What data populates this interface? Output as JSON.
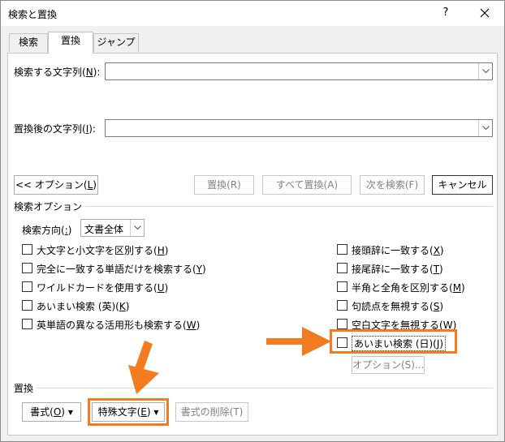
{
  "window": {
    "title": "検索と置換",
    "help_glyph": "?",
    "close_icon": "close-icon"
  },
  "tabs": [
    {
      "label": "検索",
      "active": false
    },
    {
      "label": "置換",
      "active": true
    },
    {
      "label": "ジャンプ",
      "active": false
    }
  ],
  "find": {
    "label_prefix": "検索する文字列(",
    "label_key": "N",
    "label_suffix": "):",
    "value": ""
  },
  "replace": {
    "label_prefix": "置換後の文字列(",
    "label_key": "I",
    "label_suffix": "):",
    "value": ""
  },
  "buttons": {
    "options_prefix": "<< オプション(",
    "options_key": "L",
    "options_suffix": ")",
    "replace": "置換(R)",
    "replace_all": "すべて置換(A)",
    "find_next": "次を検索(F)",
    "cancel": "キャンセル"
  },
  "search_options": {
    "title": "検索オプション",
    "direction_prefix": "検索方向(",
    "direction_key": ":",
    "direction_suffix": ")",
    "direction_value": "文書全体",
    "left": [
      {
        "prefix": "大文字と小文字を区別する(",
        "key": "H",
        "suffix": ")",
        "checked": false
      },
      {
        "prefix": "完全に一致する単語だけを検索する(",
        "key": "Y",
        "suffix": ")",
        "checked": false
      },
      {
        "prefix": "ワイルドカードを使用する(",
        "key": "U",
        "suffix": ")",
        "checked": false
      },
      {
        "prefix": "あいまい検索 (英)(",
        "key": "K",
        "suffix": ")",
        "checked": false
      },
      {
        "prefix": "英単語の異なる活用形も検索する(",
        "key": "W",
        "suffix": ")",
        "checked": false
      }
    ],
    "right": [
      {
        "prefix": "接頭辞に一致する(",
        "key": "X",
        "suffix": ")",
        "checked": false
      },
      {
        "prefix": "接尾辞に一致する(",
        "key": "T",
        "suffix": ")",
        "checked": false
      },
      {
        "prefix": "半角と全角を区別する(",
        "key": "M",
        "suffix": ")",
        "checked": false
      },
      {
        "prefix": "句読点を無視する(",
        "key": "S",
        "suffix": ")",
        "checked": false
      },
      {
        "prefix": "空白文字を無視する(",
        "key": "W",
        "suffix": ")",
        "checked": false
      },
      {
        "prefix": "あいまい検索 (日)(",
        "key": "J",
        "suffix": ")",
        "checked": false
      }
    ],
    "fuzzy_options_button": "オプション(S)..."
  },
  "replace_group": {
    "title": "置換",
    "format_prefix": "書式(",
    "format_key": "O",
    "format_suffix": ")",
    "special_prefix": "特殊文字(",
    "special_key": "E",
    "special_suffix": ")",
    "clear_format": "書式の削除(T)",
    "dropdown_glyph": "▾"
  },
  "highlight": {
    "color": "#f47c20"
  }
}
